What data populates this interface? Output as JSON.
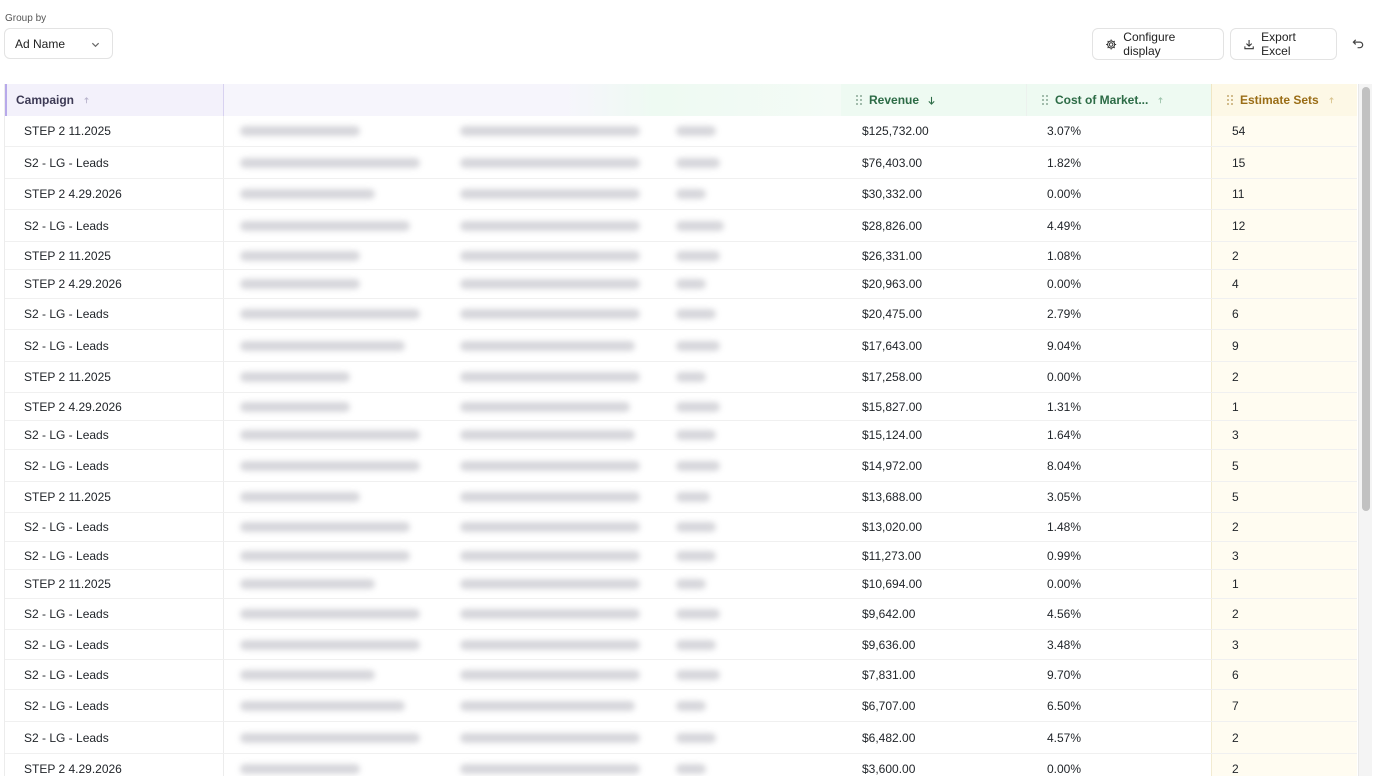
{
  "toolbar": {
    "group_by_label": "Group by",
    "group_by_value": "Ad Name",
    "configure_label": "Configure display",
    "export_label": "Export Excel"
  },
  "columns": {
    "campaign": "Campaign",
    "revenue": "Revenue",
    "cost": "Cost of Market...",
    "estimates": "Estimate Sets"
  },
  "colors": {
    "campaign_header": "#f3f1fb",
    "metric_header": "#eefaf2",
    "estimate_header": "#fdf8e6"
  },
  "rows": [
    {
      "campaign": "STEP 2 11.2025",
      "revenue": "$125,732.00",
      "cost": "3.07%",
      "estimates": "54"
    },
    {
      "campaign": "S2 - LG - Leads",
      "revenue": "$76,403.00",
      "cost": "1.82%",
      "estimates": "15"
    },
    {
      "campaign": "STEP 2 4.29.2026",
      "revenue": "$30,332.00",
      "cost": "0.00%",
      "estimates": "11"
    },
    {
      "campaign": "S2 - LG - Leads",
      "revenue": "$28,826.00",
      "cost": "4.49%",
      "estimates": "12"
    },
    {
      "campaign": "STEP 2 11.2025",
      "revenue": "$26,331.00",
      "cost": "1.08%",
      "estimates": "2"
    },
    {
      "campaign": "STEP 2 4.29.2026",
      "revenue": "$20,963.00",
      "cost": "0.00%",
      "estimates": "4"
    },
    {
      "campaign": "S2 - LG - Leads",
      "revenue": "$20,475.00",
      "cost": "2.79%",
      "estimates": "6"
    },
    {
      "campaign": "S2 - LG - Leads",
      "revenue": "$17,643.00",
      "cost": "9.04%",
      "estimates": "9"
    },
    {
      "campaign": "STEP 2 11.2025",
      "revenue": "$17,258.00",
      "cost": "0.00%",
      "estimates": "2"
    },
    {
      "campaign": "STEP 2 4.29.2026",
      "revenue": "$15,827.00",
      "cost": "1.31%",
      "estimates": "1"
    },
    {
      "campaign": "S2 - LG - Leads",
      "revenue": "$15,124.00",
      "cost": "1.64%",
      "estimates": "3"
    },
    {
      "campaign": "S2 - LG - Leads",
      "revenue": "$14,972.00",
      "cost": "8.04%",
      "estimates": "5"
    },
    {
      "campaign": "STEP 2 11.2025",
      "revenue": "$13,688.00",
      "cost": "3.05%",
      "estimates": "5"
    },
    {
      "campaign": "S2 - LG - Leads",
      "revenue": "$13,020.00",
      "cost": "1.48%",
      "estimates": "2"
    },
    {
      "campaign": "S2 - LG - Leads",
      "revenue": "$11,273.00",
      "cost": "0.99%",
      "estimates": "3"
    },
    {
      "campaign": "STEP 2 11.2025",
      "revenue": "$10,694.00",
      "cost": "0.00%",
      "estimates": "1"
    },
    {
      "campaign": "S2 - LG - Leads",
      "revenue": "$9,642.00",
      "cost": "4.56%",
      "estimates": "2"
    },
    {
      "campaign": "S2 - LG - Leads",
      "revenue": "$9,636.00",
      "cost": "3.48%",
      "estimates": "3"
    },
    {
      "campaign": "S2 - LG - Leads",
      "revenue": "$7,831.00",
      "cost": "9.70%",
      "estimates": "6"
    },
    {
      "campaign": "S2 - LG - Leads",
      "revenue": "$6,707.00",
      "cost": "6.50%",
      "estimates": "7"
    },
    {
      "campaign": "S2 - LG - Leads",
      "revenue": "$6,482.00",
      "cost": "4.57%",
      "estimates": "2"
    },
    {
      "campaign": "STEP 2 4.29.2026",
      "revenue": "$3,600.00",
      "cost": "0.00%",
      "estimates": "2"
    }
  ]
}
